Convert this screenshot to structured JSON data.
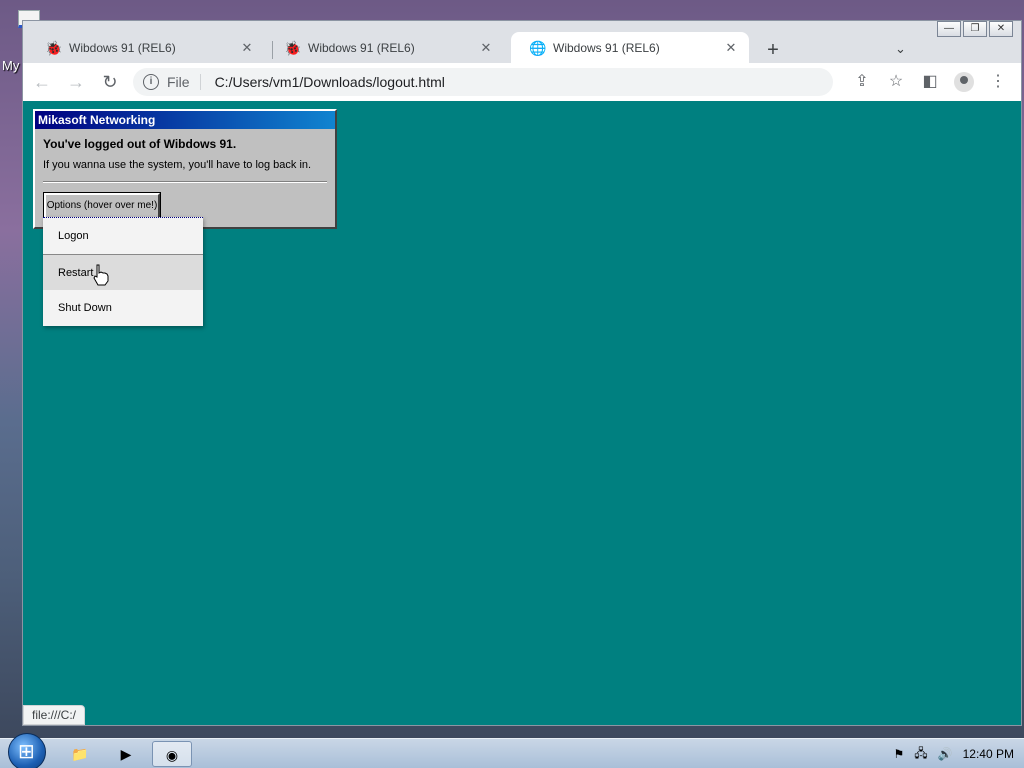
{
  "desktop": {
    "icon_label": "My"
  },
  "browser": {
    "tabs": [
      {
        "title": "Wibdows 91 (REL6)",
        "close": "✕"
      },
      {
        "title": "Wibdows 91 (REL6)",
        "close": "✕"
      },
      {
        "title": "Wibdows 91 (REL6)",
        "close": "✕"
      }
    ],
    "new_tab": "+",
    "window_buttons": {
      "minimize": "—",
      "restore": "❐",
      "close": "✕"
    },
    "address": {
      "scheme": "File",
      "url": "C:/Users/vm1/Downloads/logout.html"
    },
    "status_url": "file:///C:/"
  },
  "dialog": {
    "title": "Mikasoft Networking",
    "heading": "You've logged out of Wibdows 91.",
    "message": "If you wanna use the system, you'll have to log back in.",
    "options_button": "Options (hover over me!)",
    "menu": [
      "Logon",
      "Restart",
      "Shut Down"
    ]
  },
  "taskbar": {
    "time": "12:40 PM"
  }
}
